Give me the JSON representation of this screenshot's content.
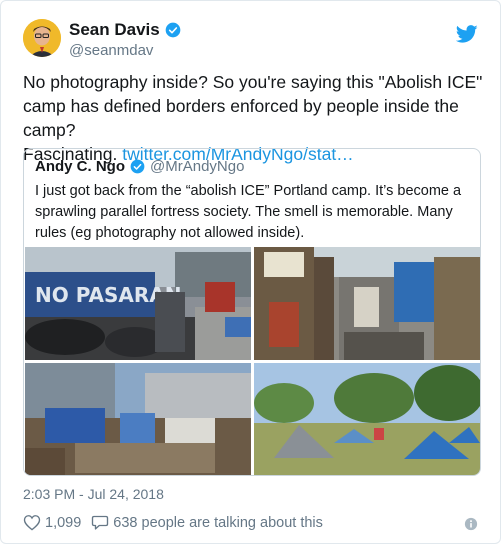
{
  "author": {
    "display_name": "Sean Davis",
    "handle": "@seanmdav"
  },
  "tweet": {
    "text_line1": "No photography inside? So you're saying this \"Abolish ICE\"",
    "text_line2": "camp has defined borders enforced by people inside the camp?",
    "text_line3_prefix": "Fascinating. ",
    "link": "twitter.com/MrAndyNgo/stat…"
  },
  "quote": {
    "display_name": "Andy C. Ngo",
    "handle": "@MrAndyNgo",
    "text": "I just got back from the “abolish ICE” Portland camp. It’s become a sprawling parallel fortress society. The smell is memorable. Many rules (eg photography not allowed inside).",
    "photos": [
      "camp-photo-1",
      "camp-photo-2",
      "camp-photo-3",
      "camp-photo-4"
    ]
  },
  "meta": {
    "timestamp": "2:03 PM - Jul 24, 2018",
    "likes": "1,099",
    "replies_text": "638 people are talking about this"
  },
  "icons": {
    "verified": "verified-badge-icon",
    "bird": "twitter-bird-icon",
    "heart": "heart-icon",
    "reply": "reply-bubble-icon",
    "info": "info-icon"
  },
  "colors": {
    "brand": "#1da1f2",
    "link": "#1b95e0",
    "muted": "#657786"
  }
}
